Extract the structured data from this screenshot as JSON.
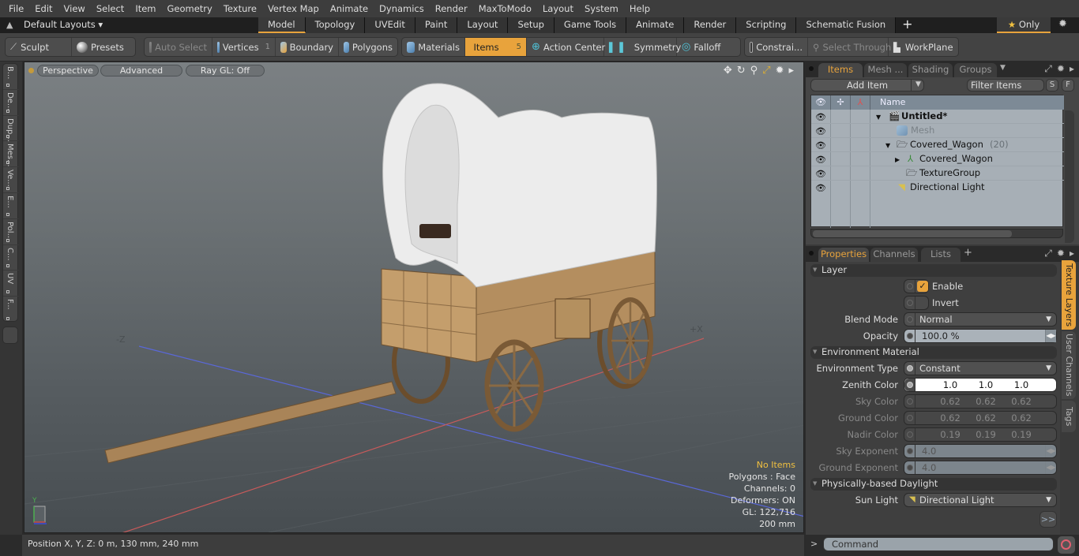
{
  "menubar": [
    "File",
    "Edit",
    "View",
    "Select",
    "Item",
    "Geometry",
    "Texture",
    "Vertex Map",
    "Animate",
    "Dynamics",
    "Render",
    "MaxToModo",
    "Layout",
    "System",
    "Help"
  ],
  "layoutbar": {
    "layout_select": "Default Layouts ▾",
    "tabs": [
      "Model",
      "Topology",
      "UVEdit",
      "Paint",
      "Layout",
      "Setup",
      "Game Tools",
      "Animate",
      "Render",
      "Scripting",
      "Schematic Fusion"
    ],
    "active_tab": "Model",
    "add_tab": "+",
    "only_label": "Only",
    "only_icon": "star-icon"
  },
  "toolbar": {
    "sculpt": "Sculpt",
    "presets": "Presets",
    "auto_select": "Auto Select",
    "vertices": "Vertices",
    "vertices_count": "1",
    "boundary": "Boundary",
    "polygons": "Polygons",
    "materials": "Materials",
    "items": "Items",
    "items_count": "5",
    "action_center": "Action Center",
    "symmetry": "Symmetry",
    "falloff": "Falloff",
    "constraints": "Constrai...",
    "select_through": "Select Through",
    "workplane": "WorkPlane"
  },
  "left_tabs": [
    "B...",
    "De...",
    "Dup...",
    "Mes...",
    "Ve...",
    "E...",
    "Pol...",
    "C...",
    "UV",
    "F..."
  ],
  "viewport": {
    "view_mode": "Perspective",
    "shading": "Advanced",
    "raygl": "Ray GL: Off",
    "axis_neg_z": "-Z",
    "axis_pos_x": "+X",
    "mini_axis_y": "Y",
    "hud": {
      "selection": "No Items",
      "polygons": "Polygons : Face",
      "channels": "Channels: 0",
      "deformers": "Deformers: ON",
      "gl": "GL: 122,716",
      "scale": "200 mm"
    },
    "colors": {
      "x_axis": "#c85a5a",
      "z_axis": "#5a68d8"
    }
  },
  "statusbar": {
    "position": "Position X, Y, Z:   0 m, 130 mm, 240 mm"
  },
  "items_panel": {
    "tabs": [
      "Items",
      "Mesh ...",
      "Shading",
      "Groups"
    ],
    "active_tab": "Items",
    "add_item": "Add Item",
    "filter_placeholder": "Filter Items",
    "s_btn": "S",
    "f_btn": "F",
    "col_name": "Name",
    "tree": [
      {
        "label": "Untitled*",
        "bold": true,
        "icon": "scene-icon",
        "count": ""
      },
      {
        "label": "Mesh",
        "dim": true,
        "icon": "mesh-icon",
        "count": ""
      },
      {
        "label": "Covered_Wagon",
        "icon": "folder-icon",
        "count": "(20)"
      },
      {
        "label": "Covered_Wagon",
        "icon": "locator-icon",
        "count": ""
      },
      {
        "label": "TextureGroup",
        "icon": "folder-icon",
        "count": ""
      },
      {
        "label": "Directional Light",
        "icon": "light-icon",
        "count": ""
      }
    ]
  },
  "properties_panel": {
    "tabs": [
      "Properties",
      "Channels",
      "Lists"
    ],
    "active_tab": "Properties",
    "add_tab": "+",
    "side_tabs": [
      "Texture Layers",
      "User Channels",
      "Tags"
    ],
    "active_side_tab": "Texture Layers",
    "sections": {
      "layer": "Layer",
      "environment": "Environment Material",
      "daylight": "Physically-based Daylight"
    },
    "enable_label": "Enable",
    "enable_checked": true,
    "invert_label": "Invert",
    "invert_checked": false,
    "blend_mode_label": "Blend Mode",
    "blend_mode": "Normal",
    "opacity_label": "Opacity",
    "opacity": "100.0 %",
    "env_type_label": "Environment Type",
    "env_type": "Constant",
    "zenith_label": "Zenith Color",
    "zenith": [
      "1.0",
      "1.0",
      "1.0"
    ],
    "sky_label": "Sky Color",
    "sky": [
      "0.62",
      "0.62",
      "0.62"
    ],
    "ground_label": "Ground Color",
    "ground": [
      "0.62",
      "0.62",
      "0.62"
    ],
    "nadir_label": "Nadir Color",
    "nadir": [
      "0.19",
      "0.19",
      "0.19"
    ],
    "sky_exp_label": "Sky Exponent",
    "sky_exp": "4.0",
    "ground_exp_label": "Ground Exponent",
    "ground_exp": "4.0",
    "sun_light_label": "Sun Light",
    "sun_light": "Directional Light",
    "more_btn": ">>"
  },
  "command": {
    "prompt": ">",
    "placeholder": "Command"
  },
  "accent_color": "#e8a33c"
}
